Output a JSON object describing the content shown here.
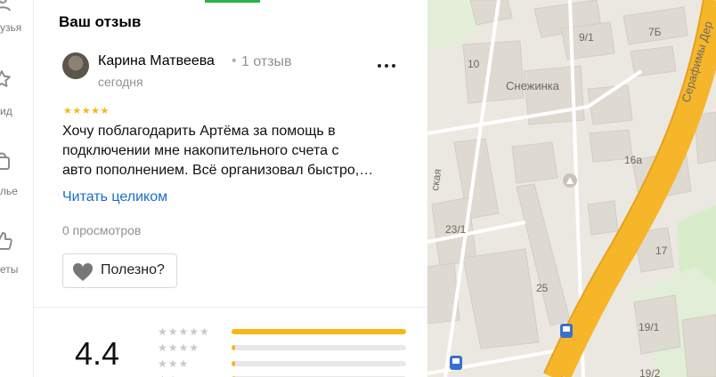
{
  "left_rail": {
    "items": [
      {
        "label": "узья",
        "icon": "people-icon"
      },
      {
        "label": "ид",
        "icon": "star-icon"
      },
      {
        "label": "лье",
        "icon": "bag-icon"
      },
      {
        "label": "еты",
        "icon": "thumb-icon"
      }
    ]
  },
  "review": {
    "section_title": "Ваш отзыв",
    "author_name": "Карина Матвеева",
    "separator": "•",
    "review_count": "1 отзыв",
    "date": "сегодня",
    "stars": "★★★★★",
    "rating": 5,
    "text_lines": [
      "Хочу поблагодарить Артёма за помощь в",
      "подключении мне накопительного счета с",
      "авто пополнением. Всё организовал быстро,…"
    ],
    "read_more": "Читать целиком",
    "views": "0 просмотров",
    "useful_label": "Полезно?",
    "more_icon": "more-dots-icon",
    "useful_icon": "heart-icon"
  },
  "summary": {
    "rating_value": "4.4",
    "distribution": [
      {
        "stars": "★★★★★",
        "fraction": 1.0
      },
      {
        "stars": "★★★★",
        "fraction": 0.02
      },
      {
        "stars": "★★★",
        "fraction": 0.02
      },
      {
        "stars": "★★",
        "fraction": 0.02
      }
    ]
  },
  "map": {
    "labels": [
      "9/1",
      "7Б",
      "10",
      "Снежинка",
      "16а",
      "23/1",
      "25",
      "17",
      "19/1",
      "19/2",
      "Серафимы Дер",
      "ская"
    ],
    "colors": {
      "road": "#f6b62a",
      "park": "#d9ecca",
      "building": "#dedad2",
      "ground": "#ebe8e1"
    }
  },
  "colors": {
    "accent": "#1a6ecb",
    "star": "#f9b617",
    "muted": "#919191",
    "tab_active": "#2bb34a"
  }
}
